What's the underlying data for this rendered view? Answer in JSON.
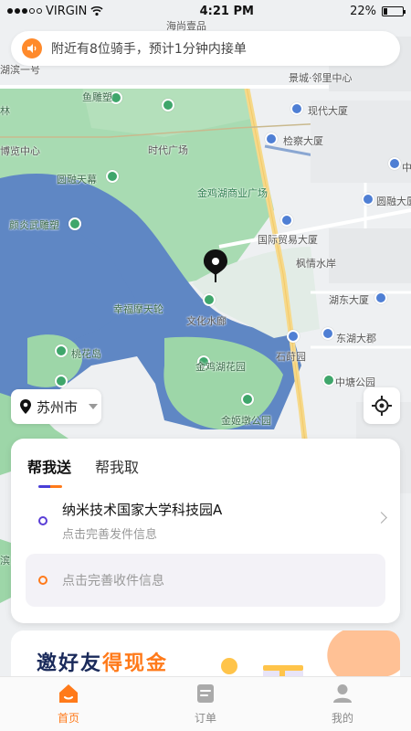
{
  "status_bar": {
    "carrier": "VIRGIN",
    "time": "4:21 PM",
    "battery": "22%",
    "battery_level": 0.22
  },
  "notice": {
    "text": "附近有8位骑手，预计1分钟内接单",
    "icon": "speaker-icon"
  },
  "map": {
    "labels": [
      "海尚壹品",
      "景城·邻里中心",
      "湖滨一号",
      "现代大厦",
      "鱼雕塑",
      "林",
      "博览中心",
      "时代广场",
      "检察大厦",
      "圆融天幕",
      "中",
      "金鸡湖商业广场",
      "圆融大厦",
      "颜炎武雕塑",
      "国际贸易大厦",
      "枫情水岸",
      "湖东大厦",
      "幸福摩天轮",
      "文化水廊",
      "东湖大郡",
      "桃花岛",
      "石莳园",
      "金鸡湖花园",
      "中塘公园",
      "金姬墩公园",
      "滨"
    ]
  },
  "city_selector": {
    "city": "苏州市"
  },
  "order_card": {
    "tabs": [
      "帮我送",
      "帮我取"
    ],
    "active_tab": 0,
    "sender": {
      "title": "纳米技术国家大学科技园A",
      "subtitle": "点击完善发件信息"
    },
    "receiver": {
      "subtitle": "点击完善收件信息"
    }
  },
  "invite_banner": {
    "prefix": "邀好友",
    "highlight": "得现金"
  },
  "tabbar": {
    "items": [
      "首页",
      "订单",
      "我的"
    ],
    "active": 0
  },
  "colors": {
    "accent_orange": "#ff7a1a",
    "accent_purple": "#5a3ed6",
    "water": "#5f87c4",
    "park": "#9dd6a8"
  }
}
